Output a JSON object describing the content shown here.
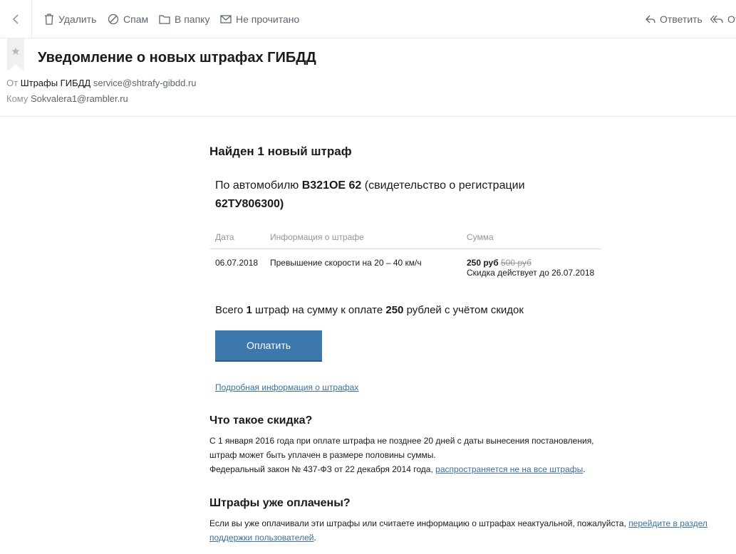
{
  "toolbar": {
    "back_label": "",
    "delete": "Удалить",
    "spam": "Спам",
    "folder": "В папку",
    "unread": "Не прочитано",
    "reply": "Ответить",
    "reply_all": "От"
  },
  "email": {
    "subject": "Уведомление о новых штрафах ГИБДД",
    "from_label": "От",
    "from_name": "Штрафы ГИБДД",
    "from_address": "service@shtrafy-gibdd.ru",
    "to_label": "Кому",
    "to_address": "Sokvalera1@rambler.ru"
  },
  "body": {
    "heading": "Найден 1 новый штраф",
    "car_prefix": "По автомобилю ",
    "car_plate": "В321ОЕ 62",
    "car_mid": " (свидетельство о регистрации ",
    "car_cert": "62ТУ806300)",
    "table": {
      "headers": [
        "Дата",
        "Информация о штрафе",
        "Сумма"
      ],
      "rows": [
        {
          "date": "06.07.2018",
          "info": "Превышение скорости на 20 – 40 км/ч",
          "amount": "250 руб",
          "old_amount": "500 руб",
          "discount_note": "Скидка действует до 26.07.2018"
        }
      ]
    },
    "total_prefix": "Всего ",
    "total_count": "1",
    "total_mid": " штраф на сумму к оплате ",
    "total_sum": "250",
    "total_suffix": " рублей с учётом скидок",
    "pay_button": "Оплатить",
    "more_link": "Подробная информация о штрафах",
    "discount_heading": "Что такое скидка?",
    "discount_line1": "С 1 января 2016 года при оплате штрафа не позднее 20 дней с даты вынесения постановления,",
    "discount_line2": "штраф может быть уплачен в размере половины суммы.",
    "discount_line3": "Федеральный закон № 437-ФЗ от 22 декабря 2014 года, ",
    "discount_link": "распространяется не на все штрафы",
    "discount_dot": ".",
    "paid_heading": "Штрафы уже оплачены?",
    "paid_line1": "Если вы уже оплачивали эти штрафы или считаете информацию о штрафах неактуальной, пожалуйста, ",
    "paid_link1": "перейдите в раздел",
    "paid_link2": "поддержки пользователей",
    "paid_dot": "."
  }
}
